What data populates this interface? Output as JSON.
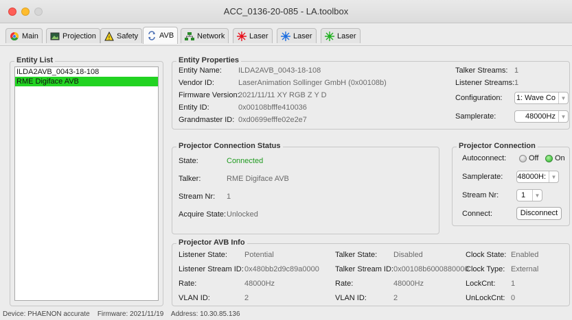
{
  "window": {
    "title": "ACC_0136-20-085  -  LA.toolbox"
  },
  "tabs": [
    {
      "label": "Main",
      "icon": "chrome-like-icon"
    },
    {
      "label": "Projection",
      "icon": "image-icon"
    },
    {
      "label": "Safety",
      "icon": "warning-icon"
    },
    {
      "label": "AVB",
      "icon": "sync-icon"
    },
    {
      "label": "Network",
      "icon": "network-icon"
    },
    {
      "label": "Laser",
      "icon": "laser-red-icon",
      "color": "#e8121e"
    },
    {
      "label": "Laser",
      "icon": "laser-blue-icon",
      "color": "#1f6fe0"
    },
    {
      "label": "Laser",
      "icon": "laser-green-icon",
      "color": "#21b021"
    }
  ],
  "entity_list": {
    "title": "Entity List",
    "items": [
      "ILDA2AVB_0043-18-108",
      "RME Digiface AVB"
    ],
    "selected_index": 1,
    "selected_color": "#22d322"
  },
  "entity_properties": {
    "title": "Entity Properties",
    "entity_name_label": "Entity Name:",
    "entity_name": "ILDA2AVB_0043-18-108",
    "vendor_id_label": "Vendor ID:",
    "vendor_id": "LaserAnimation Sollinger GmbH (0x00108b)",
    "firmware_label": "Firmware Version:",
    "firmware": "2021/11/11 XY RGB Z Y D",
    "entity_id_label": "Entity ID:",
    "entity_id": "0x00108bfffe410036",
    "grandmaster_label": "Grandmaster ID:",
    "grandmaster_id": "0xd0699efffe02e2e7",
    "talker_streams_label": "Talker Streams:",
    "talker_streams": "1",
    "listener_streams_label": "Listener Streams:",
    "listener_streams": "1",
    "configuration_label": "Configuration:",
    "configuration_value": "1: Wave Co",
    "samplerate_label": "Samplerate:",
    "samplerate_value": "48000Hz"
  },
  "connection_status": {
    "title": "Projector Connection Status",
    "state_label": "State:",
    "state": "Connected",
    "talker_label": "Talker:",
    "talker": "RME Digiface AVB",
    "stream_label": "Stream Nr:",
    "stream": "1",
    "acquire_label": "Acquire State:",
    "acquire": "Unlocked"
  },
  "projector_connection": {
    "title": "Projector Connection",
    "autoconnect_label": "Autoconnect:",
    "off_label": "Off",
    "on_label": "On",
    "autoconnect_selected": "On",
    "samplerate_label": "Samplerate:",
    "samplerate_value": "48000H:",
    "stream_label": "Stream Nr:",
    "stream_value": "1",
    "connect_label": "Connect:",
    "disconnect_button": "Disconnect"
  },
  "avb_info": {
    "title": "Projector AVB Info",
    "listener_state_label": "Listener State:",
    "listener_state": "Potential",
    "listener_stream_id_label": "Listener Stream ID:",
    "listener_stream_id": "0x480bb2d9c89a0000",
    "rate_label": "Rate:",
    "rate": "48000Hz",
    "vlan_label": "VLAN ID:",
    "vlan": "2",
    "talker_state_label": "Talker State:",
    "talker_state": "Disabled",
    "talker_stream_id_label": "Talker Stream ID:",
    "talker_stream_id": "0x00108b6000880000",
    "talker_rate_label": "Rate:",
    "talker_rate": "48000Hz",
    "talker_vlan_label": "VLAN ID:",
    "talker_vlan": "2",
    "clock_state_label": "Clock State:",
    "clock_state": "Enabled",
    "clock_type_label": "Clock Type:",
    "clock_type": "External",
    "lockcnt_label": "LockCnt:",
    "lockcnt": "1",
    "unlockcnt_label": "UnLockCnt:",
    "unlockcnt": "0"
  },
  "status_bar": {
    "text": "Device: PHAENON accurate    Firmware: 2021/11/19    Address: 10.30.85.136"
  }
}
